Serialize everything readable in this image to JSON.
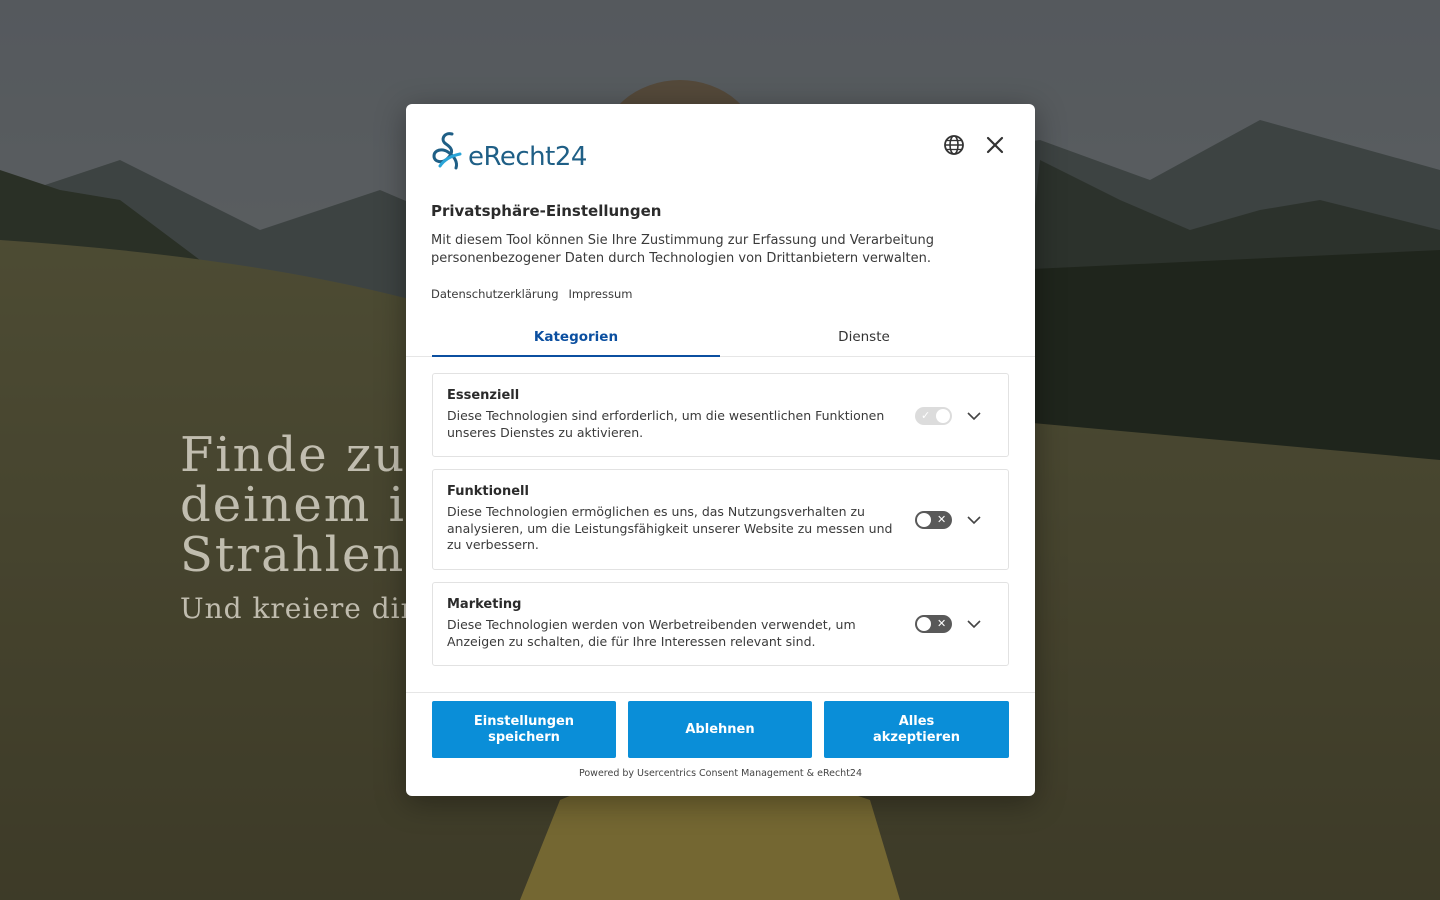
{
  "background": {
    "hero_title": "Finde zurück zu deinem inneren Strahlen.",
    "hero_subtitle": "Und kreiere dir dein Leben"
  },
  "modal": {
    "logo_text": "eRecht24",
    "title": "Privatsphäre-Einstellungen",
    "description": "Mit diesem Tool können Sie Ihre Zustimmung zur Erfassung und Verarbeitung personenbezogener Daten durch Technologien von Drittanbietern verwalten.",
    "links": {
      "privacy": "Datenschutzerklärung",
      "imprint": "Impressum"
    },
    "tabs": [
      {
        "label": "Kategorien",
        "active": true
      },
      {
        "label": "Dienste",
        "active": false
      }
    ],
    "categories": [
      {
        "title": "Essenziell",
        "text": "Diese Technologien sind erforderlich, um die wesentlichen Funktionen unseres Dienstes zu aktivieren.",
        "toggle_state": "on-disabled"
      },
      {
        "title": "Funktionell",
        "text": "Diese Technologien ermöglichen es uns, das Nutzungsverhalten zu analysieren, um die Leistungsfähigkeit unserer Website zu messen und zu verbessern.",
        "toggle_state": "off"
      },
      {
        "title": "Marketing",
        "text": "Diese Technologien werden von Werbetreibenden verwendet, um Anzeigen zu schalten, die für Ihre Interessen relevant sind.",
        "toggle_state": "off"
      }
    ],
    "buttons": {
      "save": "Einstellungen speichern",
      "deny": "Ablehnen",
      "accept": "Alles akzeptieren"
    },
    "powered_by": "Powered by Usercentrics Consent Management & eRecht24"
  },
  "colors": {
    "accent_button": "#0a8ed8",
    "active_tab": "#0b4fa0",
    "logo": "#1f5f86",
    "toggle_off": "#595959"
  }
}
